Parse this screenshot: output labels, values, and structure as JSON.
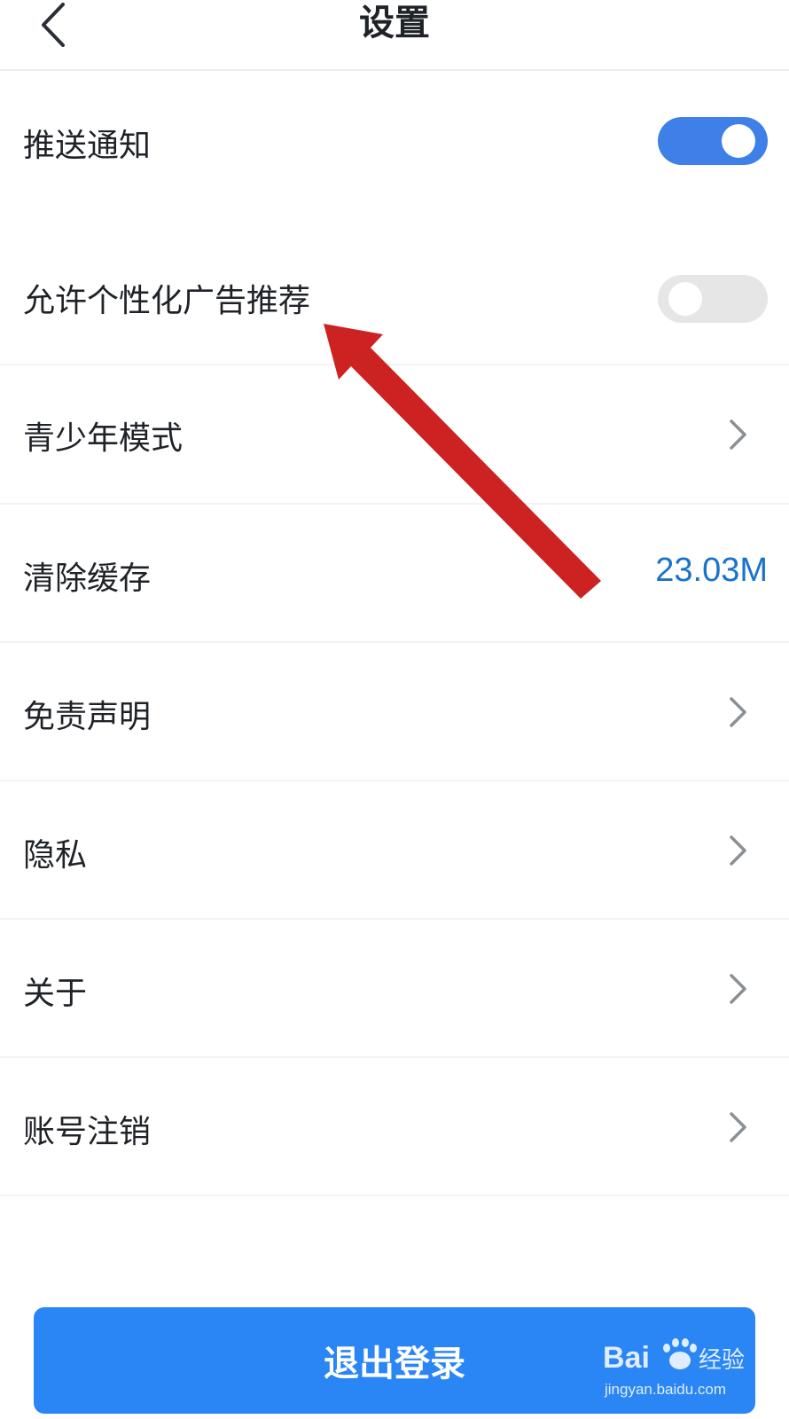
{
  "header": {
    "title": "设置"
  },
  "settings": {
    "push_notification": {
      "label": "推送通知",
      "enabled": true
    },
    "personalized_ads": {
      "label": "允许个性化广告推荐",
      "enabled": false
    },
    "youth_mode": {
      "label": "青少年模式"
    },
    "clear_cache": {
      "label": "清除缓存",
      "value": "23.03M"
    },
    "disclaimer": {
      "label": "免责声明"
    },
    "privacy": {
      "label": "隐私"
    },
    "about": {
      "label": "关于"
    },
    "account_cancel": {
      "label": "账号注销"
    }
  },
  "logout": {
    "label": "退出登录"
  },
  "watermark": {
    "brand": "Bai经验",
    "url": "jingyan.baidu.com"
  },
  "colors": {
    "accent": "#3f7fe8",
    "toggle_off": "#e6e6e6",
    "cache_value": "#1a73c8",
    "logout_bg": "#2a85f5",
    "annotation_arrow": "#cc2222"
  }
}
